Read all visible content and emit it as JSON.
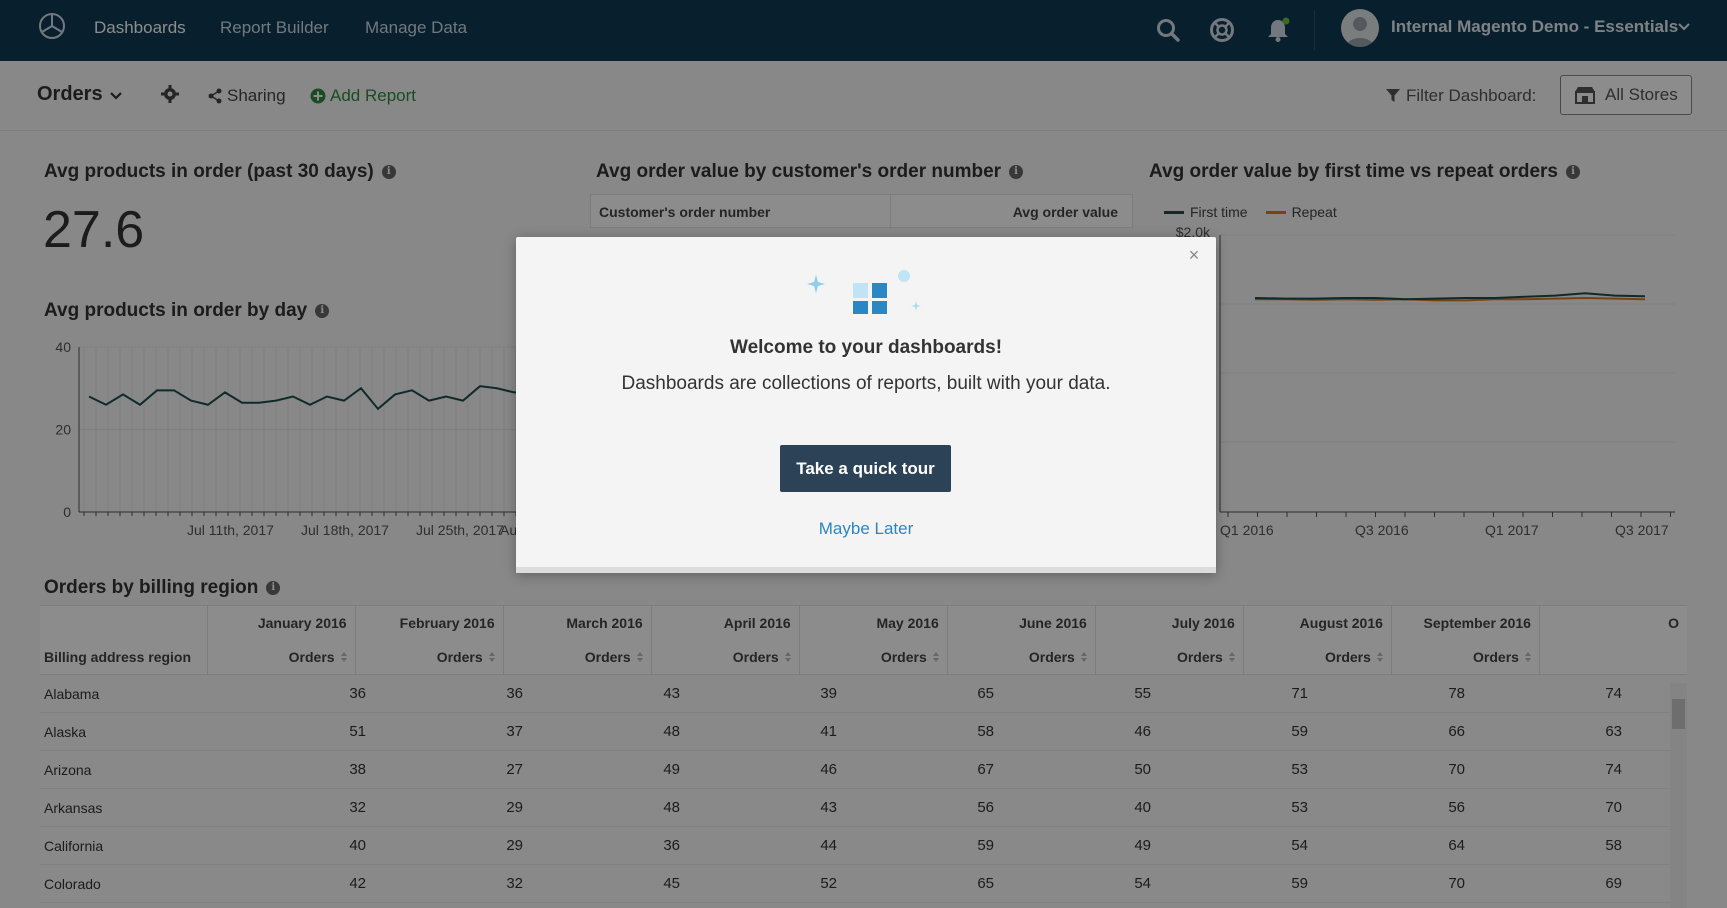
{
  "nav": {
    "links": [
      "Dashboards",
      "Report Builder",
      "Manage Data"
    ],
    "account_name": "Internal Magento Demo - Essentials",
    "icons": [
      "search-icon",
      "help-icon",
      "bell-icon"
    ]
  },
  "toolbar": {
    "dashboard_name": "Orders",
    "sharing_label": "Sharing",
    "add_report_label": "Add Report",
    "filter_label": "Filter Dashboard:",
    "stores_label": "All Stores"
  },
  "panels": {
    "avg_products_title": "Avg products in order (past 30 days)",
    "avg_products_value": "27.6",
    "by_day_title": "Avg products in order by day",
    "order_value_title": "Avg order value by customer's order number",
    "order_value_col1": "Customer's order number",
    "order_value_col2": "Avg order value",
    "first_repeat_title": "Avg order value by first time vs repeat orders",
    "region_title": "Orders by billing region"
  },
  "chart_by_day": {
    "type": "line",
    "y_ticks": [
      "40",
      "20",
      "0"
    ],
    "x_ticks": [
      "Jul 11th, 2017",
      "Jul 18th, 2017",
      "Jul 25th, 2017",
      "Au"
    ],
    "ylim": [
      0,
      40
    ],
    "values": [
      28,
      26,
      28.5,
      26,
      29.5,
      29.5,
      27,
      26,
      29,
      26.5,
      26.5,
      27,
      28,
      26,
      28,
      27,
      30,
      25,
      28.5,
      29.5,
      27,
      28,
      27,
      30.5,
      30,
      29,
      29
    ]
  },
  "chart_first_repeat": {
    "type": "line",
    "legend": [
      "First time",
      "Repeat"
    ],
    "colors": {
      "First time": "#1e4d4d",
      "Repeat": "#d97b1e"
    },
    "y_tick_top": "$2.0k",
    "x_ticks": [
      "Q1 2016",
      "Q3 2016",
      "Q1 2017",
      "Q3 2017"
    ]
  },
  "modal": {
    "close": "×",
    "title": "Welcome to your dashboards!",
    "text": "Dashboards are collections of reports, built with your data.",
    "tour_button": "Take a quick tour",
    "later_link": "Maybe Later"
  },
  "region_table": {
    "first_header": "Billing address region",
    "months": [
      "January 2016",
      "February 2016",
      "March 2016",
      "April 2016",
      "May 2016",
      "June 2016",
      "July 2016",
      "August 2016",
      "September 2016",
      "O"
    ],
    "metric": "Orders",
    "rows": [
      {
        "region": "Alabama",
        "values": [
          "36",
          "36",
          "43",
          "39",
          "65",
          "55",
          "71",
          "78",
          "74"
        ]
      },
      {
        "region": "Alaska",
        "values": [
          "51",
          "37",
          "48",
          "41",
          "58",
          "46",
          "59",
          "66",
          "63"
        ]
      },
      {
        "region": "Arizona",
        "values": [
          "38",
          "27",
          "49",
          "46",
          "67",
          "50",
          "53",
          "70",
          "74"
        ]
      },
      {
        "region": "Arkansas",
        "values": [
          "32",
          "29",
          "48",
          "43",
          "56",
          "40",
          "53",
          "56",
          "70"
        ]
      },
      {
        "region": "California",
        "values": [
          "40",
          "29",
          "36",
          "44",
          "59",
          "49",
          "54",
          "64",
          "58"
        ]
      },
      {
        "region": "Colorado",
        "values": [
          "42",
          "32",
          "45",
          "52",
          "65",
          "54",
          "59",
          "70",
          "69"
        ]
      }
    ]
  }
}
